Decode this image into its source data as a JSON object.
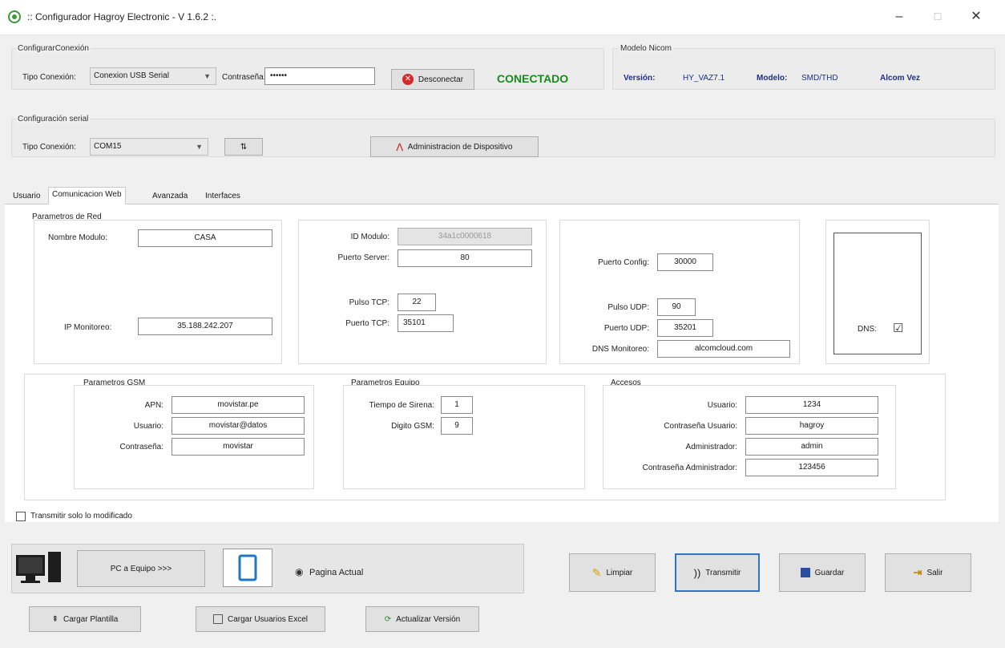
{
  "window": {
    "title": ":: Configurador Hagroy Electronic - V 1.6.2 :.",
    "minimize": "–",
    "maximize": "☐",
    "close": "✕"
  },
  "conexion": {
    "group_label": "ConfigurarConexión",
    "tipo_label": "Tipo Conexión:",
    "tipo_value": "Conexion USB Serial",
    "password_label": "Contraseña:",
    "password_value": "••••••",
    "disconnect_button": "Desconectar",
    "status": "CONECTADO",
    "status_color": "#1a8a1a"
  },
  "modelo": {
    "group_label": "Modelo Nicom",
    "version_label": "Versión:",
    "version_value": "HY_VAZ7.1",
    "modelo_label": "Modelo:",
    "modelo_value": "SMD/THD",
    "brand": "Alcom Vez"
  },
  "serial": {
    "group_label": "Configuración serial",
    "tipo_label": "Tipo Conexión:",
    "tipo_value": "COM15",
    "refresh_button": "⇅",
    "admin_button": "Administracion de Dispositivo"
  },
  "tabs": [
    "Usuario",
    "Comunicacion Web",
    "Avanzada",
    "Interfaces"
  ],
  "red": {
    "group_label": "Parametros de Red",
    "nombre_label": "Nombre Modulo:",
    "nombre_value": "CASA",
    "ip_label": "IP Monitoreo:",
    "ip_value": "35.188.242.207",
    "id_label": "ID Modulo:",
    "id_value": "34a1c0000618",
    "puerto_server_label": "Puerto Server:",
    "puerto_server_value": "80",
    "pulso_tcp_label": "Pulso TCP:",
    "pulso_tcp_value": "22",
    "puerto_tcp_label": "Puerto TCP:",
    "puerto_tcp_value": "35101",
    "puerto_config_label": "Puerto Config:",
    "puerto_config_value": "30000",
    "pulso_udp_label": "Pulso UDP:",
    "pulso_udp_value": "90",
    "puerto_udp_label": "Puerto UDP:",
    "puerto_udp_value": "35201",
    "dns_monitoreo_label": "DNS Monitoreo:",
    "dns_monitoreo_value": "alcomcloud.com",
    "dns_label": "DNS:",
    "dns_checked": "☑"
  },
  "gsm": {
    "group_label": "Parametros GSM",
    "apn_label": "APN:",
    "apn_value": "movistar.pe",
    "usuario_label": "Usuario:",
    "usuario_value": "movistar@datos",
    "password_label": "Contraseña:",
    "password_value": "movistar"
  },
  "equipo": {
    "group_label": "Parametros Equipo",
    "sirena_label": "Tiempo de Sirena:",
    "sirena_value": "1",
    "digito_label": "Digito GSM:",
    "digito_value": "9"
  },
  "accesos": {
    "group_label": "Accesos",
    "usuario_label": "Usuario:",
    "usuario_value": "1234",
    "pass_usuario_label": "Contraseña Usuario:",
    "pass_usuario_value": "hagroy",
    "admin_label": "Administrador:",
    "admin_value": "admin",
    "pass_admin_label": "Contraseña Administrador:",
    "pass_admin_value": "123456"
  },
  "transmitir_modificado": "Transmitir solo lo modificado",
  "bottom": {
    "pc_equipo": "PC a Equipo >>>",
    "pagina_actual": "Pagina Actual",
    "limpiar": "Limpiar",
    "transmitir": "Transmitir",
    "guardar": "Guardar",
    "salir": "Salir",
    "cargar_plantilla": "Cargar Plantilla",
    "cargar_usuarios": "Cargar Usuarios Excel",
    "actualizar_version": "Actualizar Versión"
  }
}
